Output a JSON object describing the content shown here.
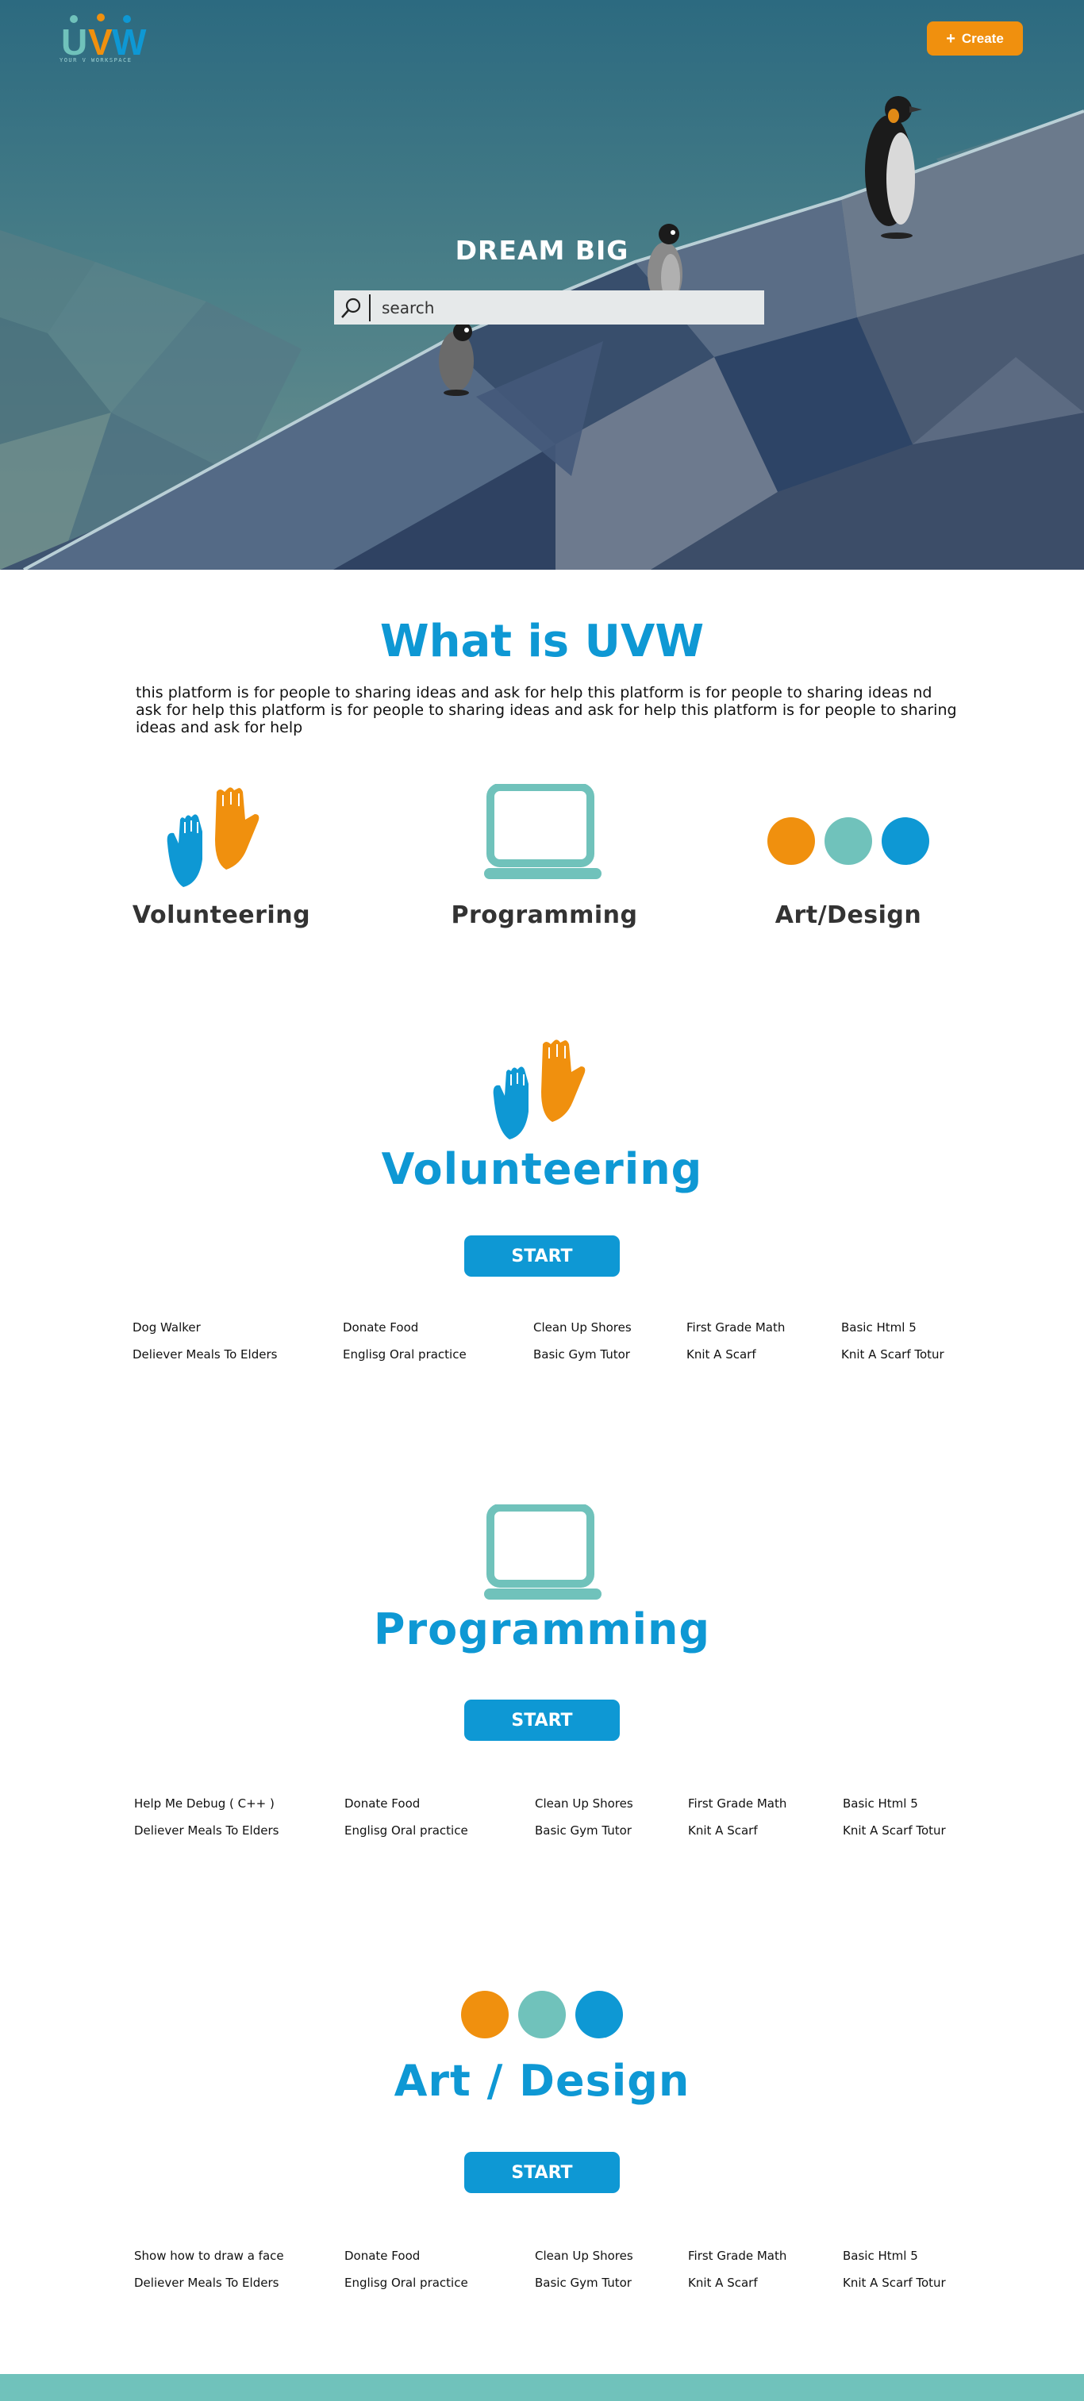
{
  "header": {
    "logo_text": "UVW",
    "logo_tagline": "YOUR V WORKSPACE",
    "create_button": "Create"
  },
  "hero": {
    "title": "DREAM BIG",
    "search_placeholder": "search"
  },
  "about": {
    "title": "What is UVW",
    "text": "this platform is for people to sharing ideas and ask for help  this platform is for people to sharing ideas nd ask for help this platform is for people to sharing ideas and ask for help  this platform is for people to sharing ideas and ask for help"
  },
  "categories": [
    {
      "label": "Volunteering",
      "icon": "raised-hands-icon"
    },
    {
      "label": "Programming",
      "icon": "laptop-icon"
    },
    {
      "label": "Art/Design",
      "icon": "color-dots-icon"
    }
  ],
  "sections": [
    {
      "title": "Volunteering",
      "start": "START",
      "tasks": [
        [
          "Dog Walker",
          "Donate Food",
          "Clean Up Shores",
          "First Grade Math",
          "Basic Html 5"
        ],
        [
          "Deliever Meals To Elders",
          "Englisg Oral practice",
          "Basic Gym Tutor",
          "Knit A Scarf",
          "Knit A Scarf Totur"
        ]
      ]
    },
    {
      "title": "Programming",
      "start": "START",
      "tasks": [
        [
          "Help Me Debug ( C++ )",
          "Donate Food",
          "Clean Up Shores",
          "First Grade Math",
          "Basic Html 5"
        ],
        [
          "Deliever Meals To Elders",
          "Englisg Oral practice",
          "Basic Gym Tutor",
          "Knit A Scarf",
          "Knit A Scarf Totur"
        ]
      ]
    },
    {
      "title": "Art / Design",
      "start": "START",
      "tasks": [
        [
          "Show how to draw a face",
          "Donate Food",
          "Clean Up Shores",
          "First Grade Math",
          "Basic Html 5"
        ],
        [
          "Deliever Meals To Elders",
          "Englisg Oral practice",
          "Basic Gym Tutor",
          "Knit A Scarf",
          "Knit A Scarf Totur"
        ]
      ]
    }
  ],
  "colors": {
    "brand_blue": "#0e98d4",
    "brand_orange": "#f0900e",
    "brand_teal": "#70c2bb",
    "hero_sky": "#2f6a80"
  }
}
